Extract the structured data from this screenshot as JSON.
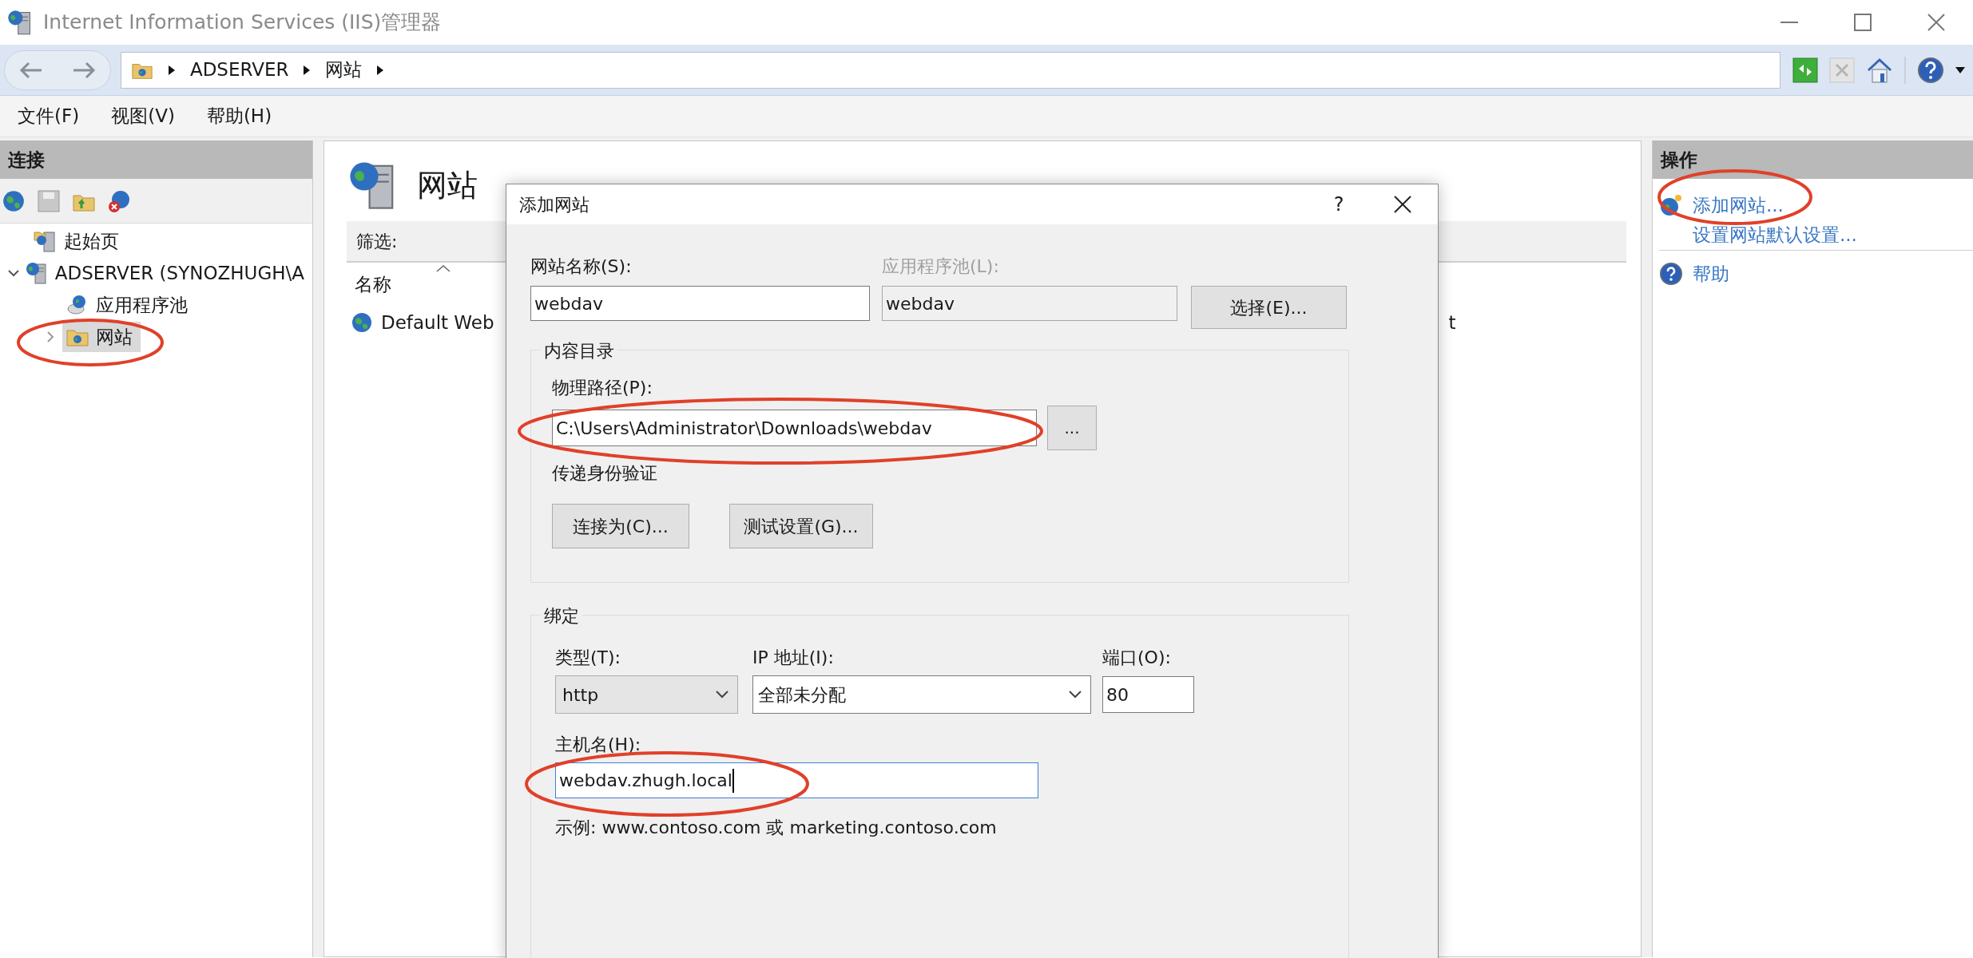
{
  "window": {
    "title": "Internet Information Services (IIS)管理器"
  },
  "address_bar": {
    "crumbs": [
      "ADSERVER",
      "网站"
    ]
  },
  "menu": [
    "文件(F)",
    "视图(V)",
    "帮助(H)"
  ],
  "connections": {
    "title": "连接",
    "tree": [
      {
        "label": "起始页",
        "kind": "start",
        "selected": false
      },
      {
        "label": "ADSERVER (SYNOZHUGH\\A",
        "kind": "server",
        "expanded": true,
        "selected": false,
        "children": [
          {
            "label": "应用程序池",
            "kind": "pool",
            "selected": false
          },
          {
            "label": "网站",
            "kind": "sites",
            "expanded": false,
            "selected": true
          }
        ]
      }
    ]
  },
  "content": {
    "title": "网站",
    "filter_label": "筛选:",
    "columns": [
      "名称"
    ],
    "rows": [
      {
        "name": "Default Web",
        "column_2": "t"
      }
    ]
  },
  "actions": {
    "title": "操作",
    "items": [
      {
        "label": "添加网站...",
        "kind": "add"
      },
      {
        "label": "设置网站默认设置...",
        "kind": "plain"
      },
      {
        "label": "帮助",
        "kind": "help"
      }
    ]
  },
  "dialog": {
    "title": "添加网站",
    "help": "?",
    "site_name": {
      "label": "网站名称(S):",
      "value": "webdav"
    },
    "app_pool": {
      "label": "应用程序池(L):",
      "value": "webdav",
      "disabled": true
    },
    "select_button": "选择(E)...",
    "content_group": {
      "title": "内容目录",
      "path_label": "物理路径(P):",
      "path_value": "C:\\Users\\Administrator\\Downloads\\webdav",
      "browse_button": "...",
      "auth_label": "传递身份验证",
      "buttons": [
        "连接为(C)...",
        "测试设置(G)..."
      ]
    },
    "binding": {
      "title": "绑定",
      "type_label": "类型(T):",
      "type_value": "http",
      "ip_label": "IP 地址(I):",
      "ip_value": "全部未分配",
      "port_label": "端口(O):",
      "port_value": "80",
      "host_label": "主机名(H):",
      "host_value": "webdav.zhugh.local",
      "host_focused": true,
      "example": "示例: www.contoso.com 或 marketing.contoso.com"
    }
  }
}
